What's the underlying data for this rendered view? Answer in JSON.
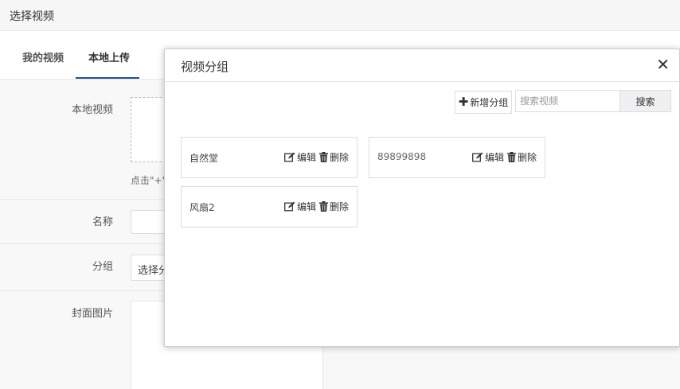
{
  "window": {
    "title": "选择视频"
  },
  "tabs": [
    {
      "label": "我的视频"
    },
    {
      "label": "本地上传",
      "active": true
    }
  ],
  "form": {
    "local_video_label": "本地视频",
    "upload_hint": "点击\"+\"",
    "name_label": "名称",
    "group_label": "分组",
    "group_select_value": "选择分",
    "cover_label": "封面图片"
  },
  "modal": {
    "title": "视频分组",
    "close_glyph": "✕",
    "add_group_label": "新增分组",
    "search_placeholder": "搜索视频",
    "search_button_label": "搜索",
    "edit_label": "编辑",
    "delete_label": "删除",
    "groups": [
      {
        "name": "自然堂"
      },
      {
        "name": "89899898"
      },
      {
        "name": "风扇2"
      }
    ]
  },
  "colors": {
    "accent": "#1e50a2"
  }
}
